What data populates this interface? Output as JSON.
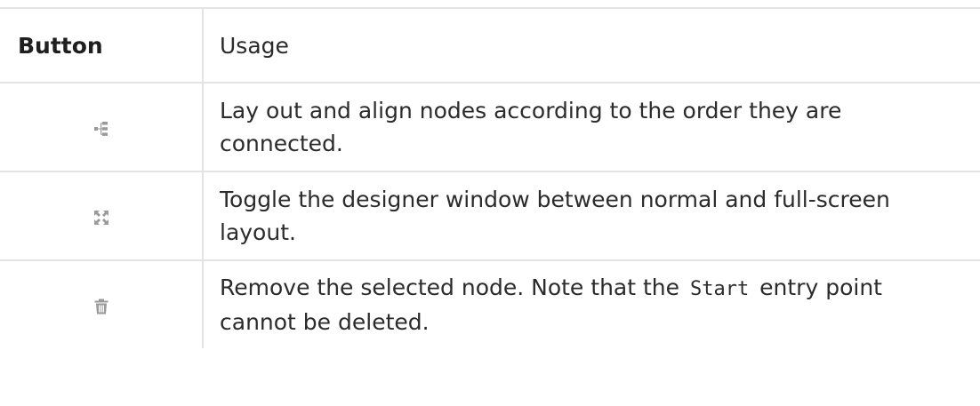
{
  "table": {
    "headers": {
      "button": "Button",
      "usage": "Usage"
    },
    "rows": [
      {
        "icon": "layout-tree-icon",
        "usage": "Lay out and align nodes according to the order they are connected."
      },
      {
        "icon": "fullscreen-toggle-icon",
        "usage": "Toggle the designer window between normal and full-screen layout."
      },
      {
        "icon": "trash-icon",
        "usage_before": "Remove the selected node. Note that the",
        "usage_code": "Start",
        "usage_after": "entry point cannot be deleted."
      }
    ]
  }
}
